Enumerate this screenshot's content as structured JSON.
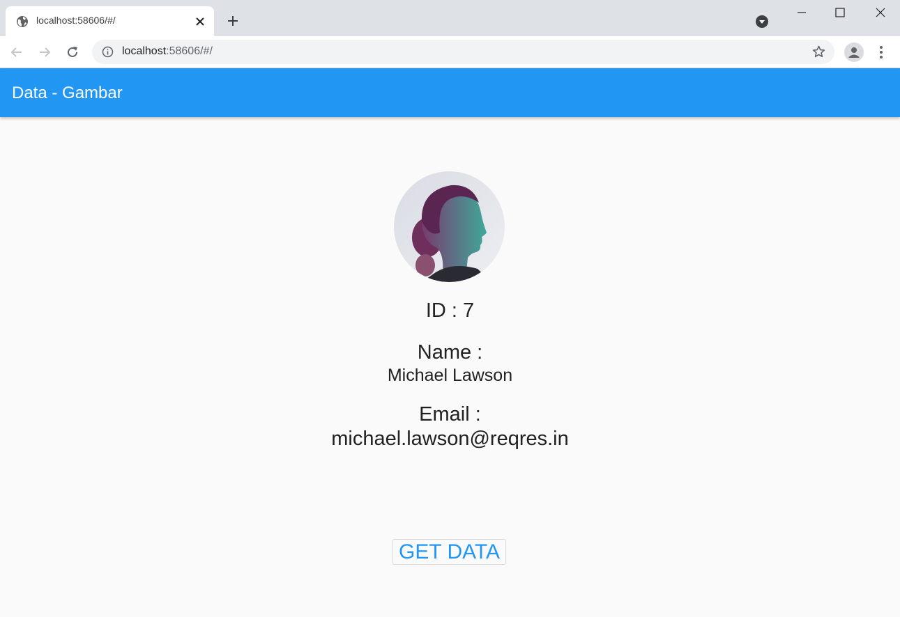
{
  "browser": {
    "tab": {
      "title": "localhost:58606/#/",
      "favicon": "globe-icon"
    },
    "address": {
      "host": "localhost",
      "rest": ":58606/#/"
    }
  },
  "app": {
    "title": "Data - Gambar",
    "colors": {
      "primary": "#2196f3",
      "background": "#fafafa",
      "text": "#212121"
    }
  },
  "user": {
    "avatar": "woman-portrait-avatar",
    "id_line": "ID : 7",
    "name_label": "Name :",
    "name_value": "Michael Lawson",
    "email_label": "Email :",
    "email_value": "michael.lawson@reqres.in"
  },
  "actions": {
    "get_data_label": "GET DATA"
  }
}
